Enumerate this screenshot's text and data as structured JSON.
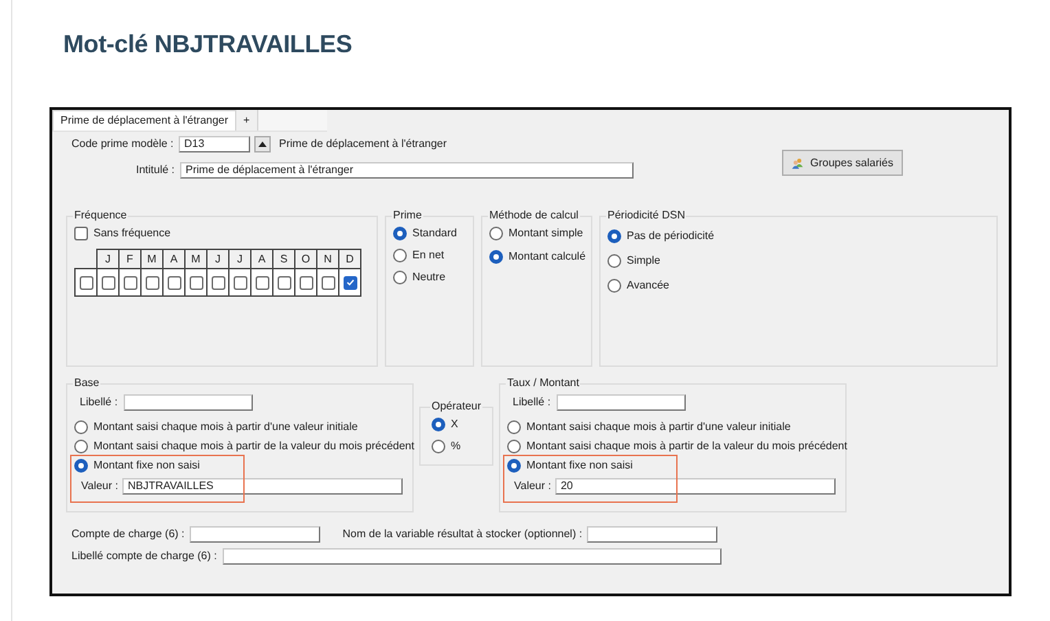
{
  "page_title": "Mot-clé NBJTRAVAILLES",
  "tabs": [
    {
      "label": "Prime de déplacement à l'étranger",
      "selected": true
    },
    {
      "label": "+",
      "selected": false
    }
  ],
  "code_prime": {
    "label": "Code prime modèle :",
    "value": "D13",
    "description": "Prime de déplacement à l'étranger"
  },
  "intitule": {
    "label": "Intitulé :",
    "value": "Prime de déplacement à l'étranger"
  },
  "groupes_button": "Groupes salariés",
  "frequence": {
    "title": "Fréquence",
    "sans_frequence": {
      "label": "Sans fréquence",
      "checked": false
    },
    "row_checkbox": {
      "checked": false
    },
    "months": [
      {
        "label": "J",
        "checked": false
      },
      {
        "label": "F",
        "checked": false
      },
      {
        "label": "M",
        "checked": false
      },
      {
        "label": "A",
        "checked": false
      },
      {
        "label": "M",
        "checked": false
      },
      {
        "label": "J",
        "checked": false
      },
      {
        "label": "J",
        "checked": false
      },
      {
        "label": "A",
        "checked": false
      },
      {
        "label": "S",
        "checked": false
      },
      {
        "label": "O",
        "checked": false
      },
      {
        "label": "N",
        "checked": false
      },
      {
        "label": "D",
        "checked": true
      }
    ]
  },
  "prime": {
    "title": "Prime",
    "options": [
      {
        "label": "Standard",
        "selected": true
      },
      {
        "label": "En net",
        "selected": false
      },
      {
        "label": "Neutre",
        "selected": false
      }
    ]
  },
  "methode": {
    "title": "Méthode de calcul",
    "options": [
      {
        "label": "Montant simple",
        "selected": false
      },
      {
        "label": "Montant calculé",
        "selected": true
      }
    ]
  },
  "periodicite": {
    "title": "Périodicité DSN",
    "options": [
      {
        "label": "Pas de périodicité",
        "selected": true
      },
      {
        "label": "Simple",
        "selected": false
      },
      {
        "label": "Avancée",
        "selected": false
      }
    ]
  },
  "base": {
    "title": "Base",
    "libelle_label": "Libellé :",
    "options": [
      {
        "label": "Montant saisi chaque mois à partir d'une valeur initiale",
        "selected": false
      },
      {
        "label": "Montant saisi chaque mois à partir de la valeur du mois précédent",
        "selected": false
      },
      {
        "label": "Montant fixe non saisi",
        "selected": true
      }
    ],
    "valeur_label": "Valeur :",
    "valeur": "NBJTRAVAILLES",
    "highlighted": true
  },
  "operateur": {
    "title": "Opérateur",
    "options": [
      {
        "label": "X",
        "selected": true
      },
      {
        "label": "%",
        "selected": false
      }
    ]
  },
  "taux": {
    "title": "Taux / Montant",
    "libelle_label": "Libellé :",
    "options": [
      {
        "label": "Montant saisi chaque mois à partir d'une valeur initiale",
        "selected": false
      },
      {
        "label": "Montant saisi chaque mois à partir de la valeur du mois précédent",
        "selected": false
      },
      {
        "label": "Montant fixe non saisi",
        "selected": true
      }
    ],
    "valeur_label": "Valeur :",
    "valeur": "20",
    "highlighted": true
  },
  "compte_charge": {
    "label": "Compte de charge (6) :"
  },
  "variable": {
    "label": "Nom de la variable résultat à stocker (optionnel) :"
  },
  "libelle_compte": {
    "label": "Libellé compte de charge (6) :"
  }
}
